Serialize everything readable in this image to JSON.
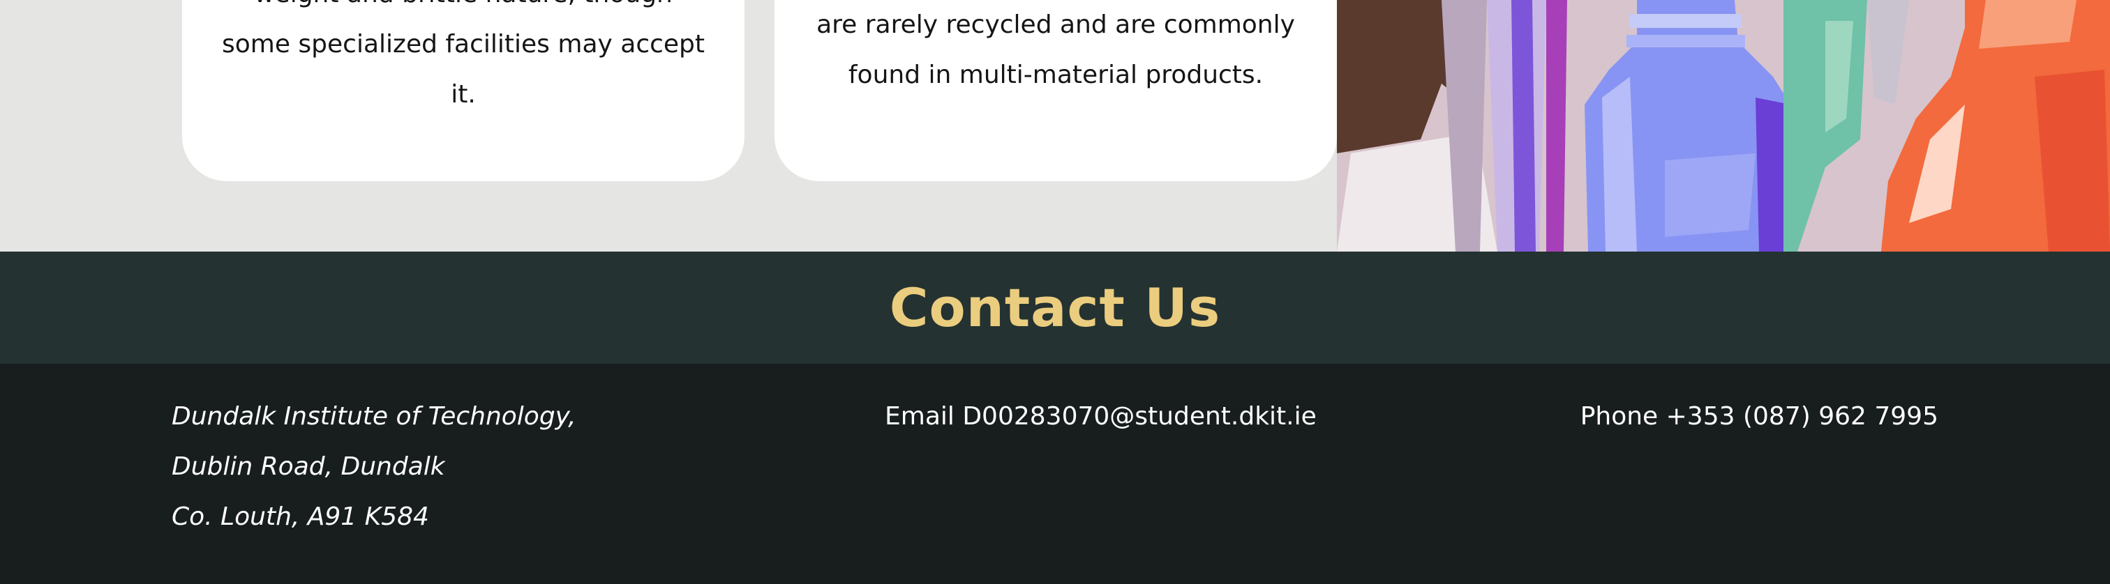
{
  "cards": [
    {
      "lines": [
        "weight and brittle nature, though",
        "some specialized facilities may accept",
        "it."
      ]
    },
    {
      "lines": [
        "are rarely recycled and are commonly",
        "found in multi-material products."
      ]
    }
  ],
  "artwork": {
    "subject": "painted plastic bottles illustration",
    "colors": [
      "#5b3a2e",
      "#8a6cf0",
      "#7a86f5",
      "#6fc1a8",
      "#f26a3d",
      "#b037b5"
    ]
  },
  "contact": {
    "title": "Contact Us",
    "title_color": "#ebcd7f",
    "address_lines": [
      "Dundalk Institute of Technology,",
      "Dublin Road, Dundalk",
      "Co. Louth, A91 K584"
    ],
    "email_label": "Email D00283070@student.dkit.ie",
    "phone_label": "Phone +353 (087) 962 7995"
  },
  "colors": {
    "page_background": "#e5e5e3",
    "header_background": "#243231",
    "footer_background": "#171e1d",
    "card_background": "#ffffff"
  }
}
